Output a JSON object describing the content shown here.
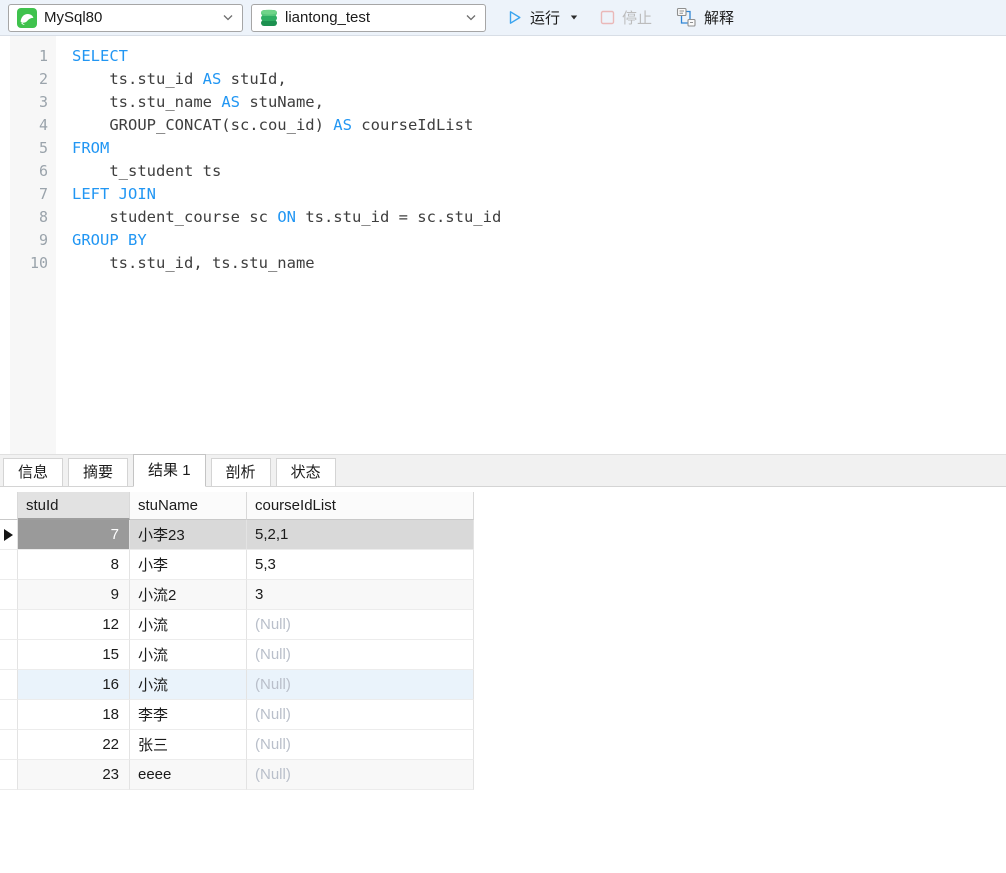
{
  "toolbar": {
    "connection": {
      "value": "MySql80",
      "icon": "mysql-icon"
    },
    "database": {
      "value": "liantong_test",
      "icon": "database-icon"
    },
    "run_label": "运行",
    "stop_label": "停止",
    "explain_label": "解释"
  },
  "editor": {
    "language": "sql",
    "lines": [
      {
        "n": "1",
        "segments": [
          {
            "t": "SELECT",
            "c": "k"
          }
        ]
      },
      {
        "n": "2",
        "segments": [
          {
            "t": "    ts.stu_id ",
            "c": "p"
          },
          {
            "t": "AS",
            "c": "k"
          },
          {
            "t": " stuId,",
            "c": "p"
          }
        ]
      },
      {
        "n": "3",
        "segments": [
          {
            "t": "    ts.stu_name ",
            "c": "p"
          },
          {
            "t": "AS",
            "c": "k"
          },
          {
            "t": " stuName,",
            "c": "p"
          }
        ]
      },
      {
        "n": "4",
        "segments": [
          {
            "t": "    GROUP_CONCAT(sc.cou_id) ",
            "c": "p"
          },
          {
            "t": "AS",
            "c": "k"
          },
          {
            "t": " courseIdList",
            "c": "p"
          }
        ]
      },
      {
        "n": "5",
        "segments": [
          {
            "t": "FROM",
            "c": "k"
          }
        ]
      },
      {
        "n": "6",
        "segments": [
          {
            "t": "    t_student ts",
            "c": "p"
          }
        ]
      },
      {
        "n": "7",
        "segments": [
          {
            "t": "LEFT JOIN",
            "c": "k"
          }
        ]
      },
      {
        "n": "8",
        "segments": [
          {
            "t": "    student_course sc ",
            "c": "p"
          },
          {
            "t": "ON",
            "c": "k"
          },
          {
            "t": " ts.stu_id = sc.stu_id",
            "c": "p"
          }
        ]
      },
      {
        "n": "9",
        "segments": [
          {
            "t": "GROUP BY",
            "c": "k"
          }
        ]
      },
      {
        "n": "10",
        "segments": [
          {
            "t": "    ts.stu_id, ts.stu_name",
            "c": "p"
          }
        ]
      }
    ]
  },
  "tabs": [
    {
      "id": "info",
      "label": "信息",
      "active": false
    },
    {
      "id": "summary",
      "label": "摘要",
      "active": false
    },
    {
      "id": "result",
      "label": "结果 1",
      "active": true
    },
    {
      "id": "profile",
      "label": "剖析",
      "active": false
    },
    {
      "id": "status",
      "label": "状态",
      "active": false
    }
  ],
  "result_table": {
    "columns": [
      "stuId",
      "stuName",
      "courseIdList"
    ],
    "selected_column": "stuId",
    "null_display": "(Null)",
    "rows": [
      {
        "stuId": "7",
        "stuName": "小李23",
        "courseIdList": "5,2,1",
        "is_null": false,
        "state": "selected"
      },
      {
        "stuId": "8",
        "stuName": "小李",
        "courseIdList": "5,3",
        "is_null": false,
        "state": ""
      },
      {
        "stuId": "9",
        "stuName": "小流2",
        "courseIdList": "3",
        "is_null": false,
        "state": "shaded"
      },
      {
        "stuId": "12",
        "stuName": "小流",
        "courseIdList": "(Null)",
        "is_null": true,
        "state": ""
      },
      {
        "stuId": "15",
        "stuName": "小流",
        "courseIdList": "(Null)",
        "is_null": true,
        "state": ""
      },
      {
        "stuId": "16",
        "stuName": "小流",
        "courseIdList": "(Null)",
        "is_null": true,
        "state": "hover"
      },
      {
        "stuId": "18",
        "stuName": "李李",
        "courseIdList": "(Null)",
        "is_null": true,
        "state": ""
      },
      {
        "stuId": "22",
        "stuName": "张三",
        "courseIdList": "(Null)",
        "is_null": true,
        "state": ""
      },
      {
        "stuId": "23",
        "stuName": "eeee",
        "courseIdList": "(Null)",
        "is_null": true,
        "state": "shaded"
      }
    ]
  },
  "colors": {
    "keyword_blue": "#2196f3",
    "run_accent": "#3aa4ef",
    "mysql_green": "#3fc24d",
    "db_green": "#2aa85c",
    "selected_cell_bg": "#9a9a9a",
    "selected_row_bg": "#d9d9d9",
    "null_text": "#b9bfca",
    "toolbar_bg": "#edf3fa"
  }
}
